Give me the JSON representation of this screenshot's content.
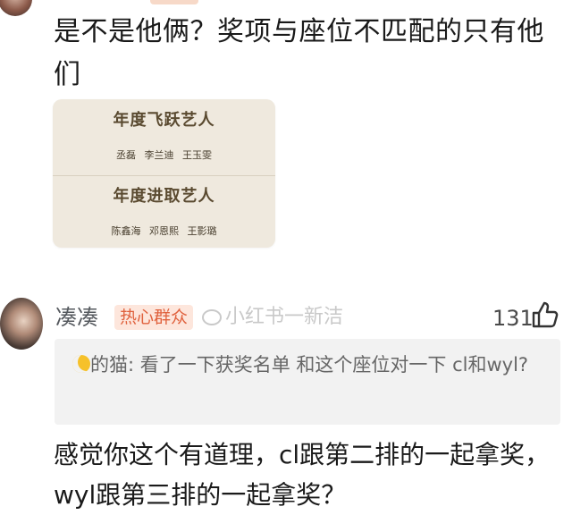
{
  "post": {
    "text": "是不是他俩？奖项与座位不匹配的只有他们"
  },
  "award_card": {
    "award1_title": "年度飞跃艺人",
    "award1_names": "丞磊 李兰迪 王玉雯",
    "award2_title": "年度进取艺人",
    "award2_names": "陈鑫海 邓恩熙 王影璐"
  },
  "comment": {
    "username": "凑凑",
    "badge": "热心群众",
    "watermark": "小红书一新洁",
    "likes": "131",
    "quote_author": "的猫:",
    "quote_text": " 看了一下获奖名单 和这个座位对一下 cl和wyl?",
    "reply": "感觉你这个有道理，cl跟第二排的一起拿奖，wyl跟第三排的一起拿奖？"
  },
  "icons": {
    "like": "thumbs-up-icon",
    "quote_emoji": "crescent-moon-icon",
    "watermark_logo": "weibo-logo-icon"
  },
  "colors": {
    "badge_bg": "#fde6dc",
    "badge_text": "#e0623e",
    "card_bg": "#efe9de",
    "quote_bg": "#f2f2f2"
  }
}
